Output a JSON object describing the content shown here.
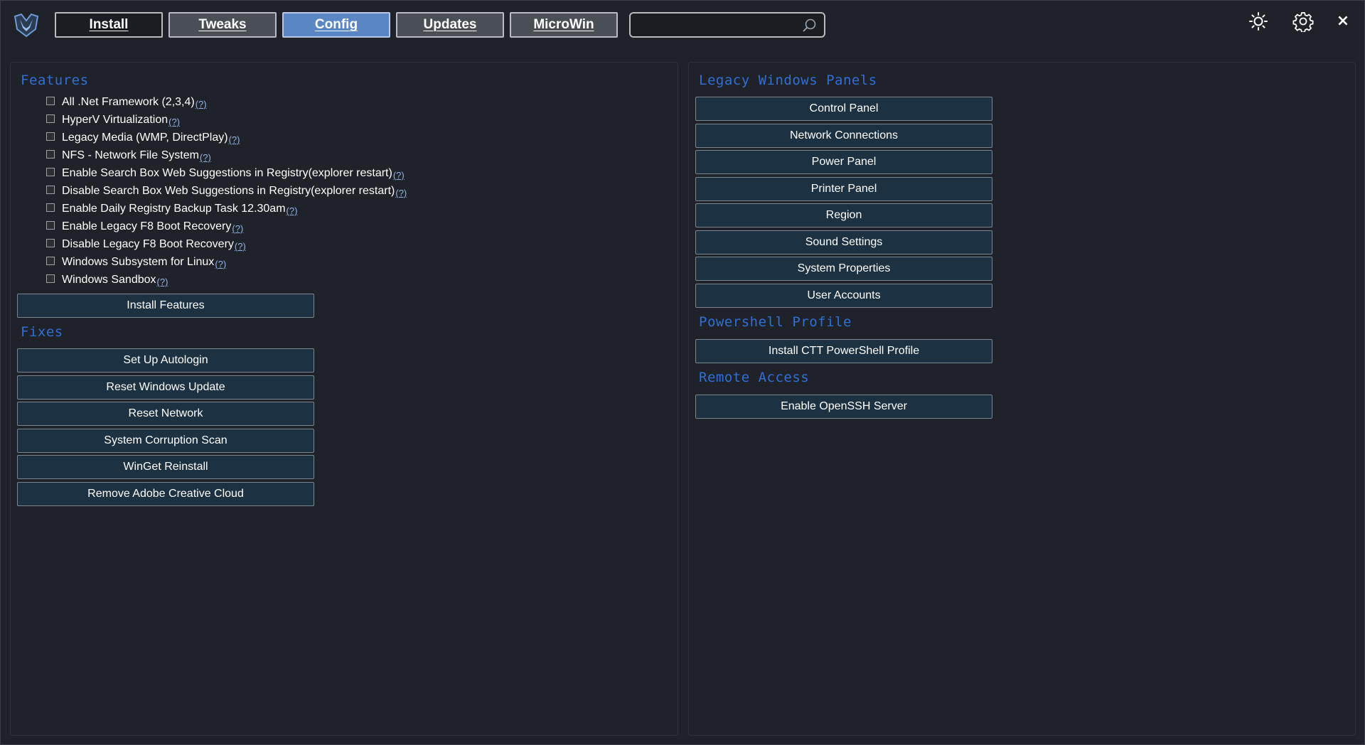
{
  "header": {
    "tabs": [
      {
        "label": "Install"
      },
      {
        "label": "Tweaks"
      },
      {
        "label": "Config"
      },
      {
        "label": "Updates"
      },
      {
        "label": "MicroWin"
      }
    ],
    "active_tab": "Config",
    "search": {
      "value": "",
      "placeholder": ""
    },
    "icons": [
      "logo-icon",
      "search-icon",
      "theme-toggle-icon",
      "settings-gear-icon",
      "close-icon"
    ],
    "close_glyph": "×"
  },
  "features": {
    "title": "Features",
    "help_label": "(?)",
    "items": [
      {
        "label": "All .Net Framework (2,3,4)"
      },
      {
        "label": "HyperV Virtualization"
      },
      {
        "label": "Legacy Media (WMP, DirectPlay)"
      },
      {
        "label": "NFS - Network File System"
      },
      {
        "label": "Enable Search Box Web Suggestions in Registry(explorer restart)"
      },
      {
        "label": "Disable Search Box Web Suggestions in Registry(explorer restart)"
      },
      {
        "label": "Enable Daily Registry Backup Task 12.30am"
      },
      {
        "label": "Enable Legacy F8 Boot Recovery"
      },
      {
        "label": "Disable Legacy F8 Boot Recovery"
      },
      {
        "label": "Windows Subsystem for Linux"
      },
      {
        "label": "Windows Sandbox"
      }
    ],
    "install_button": "Install Features"
  },
  "fixes": {
    "title": "Fixes",
    "buttons": [
      "Set Up Autologin",
      "Reset Windows Update",
      "Reset Network",
      "System Corruption Scan",
      "WinGet Reinstall",
      "Remove Adobe Creative Cloud"
    ]
  },
  "legacy_panels": {
    "title": "Legacy Windows Panels",
    "buttons": [
      "Control Panel",
      "Network Connections",
      "Power Panel",
      "Printer Panel",
      "Region",
      "Sound Settings",
      "System Properties",
      "User Accounts"
    ]
  },
  "powershell_profile": {
    "title": "Powershell Profile",
    "buttons": [
      "Install CTT PowerShell Profile"
    ]
  },
  "remote_access": {
    "title": "Remote Access",
    "buttons": [
      "Enable OpenSSH Server"
    ]
  },
  "colors": {
    "background": "#1f2329",
    "section_title": "#2f6fd8",
    "button_bg": "#1c3142",
    "active_tab": "#5b86c4"
  }
}
